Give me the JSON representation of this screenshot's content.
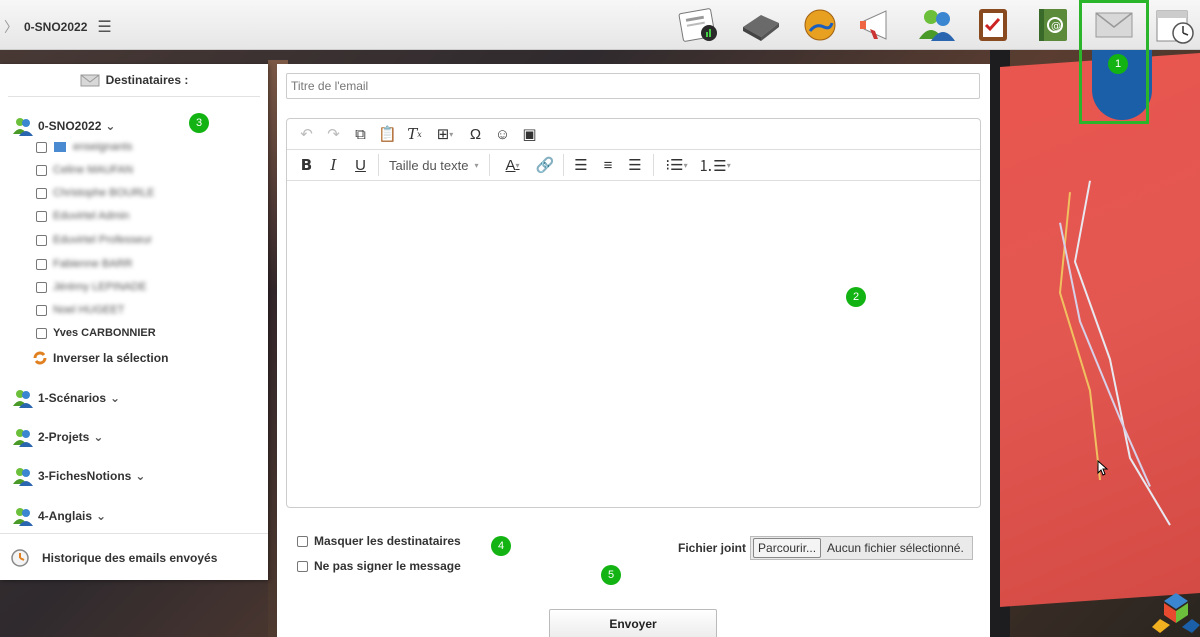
{
  "topbar": {
    "crumb": "0-SNO2022",
    "icons": [
      "newspaper-icon",
      "folder-icon",
      "web-link-icon",
      "megaphone-icon",
      "users-icon",
      "checklist-icon",
      "address-book-icon",
      "mail-icon",
      "calendar-clock-icon"
    ]
  },
  "left": {
    "header": "Destinataires :",
    "groups": [
      {
        "name": "0-SNO2022"
      },
      {
        "name": "1-Scénarios"
      },
      {
        "name": "2-Projets"
      },
      {
        "name": "3-FichesNotions"
      },
      {
        "name": "4-Anglais"
      }
    ],
    "members": [
      "enseignants",
      "Celine MAUFAN",
      "Christophe BOURLE",
      "Eduvirtel Admin",
      "Eduvirtel Professeur",
      "Fabienne BARR",
      "Jérémy LEPINADE",
      "Noel HUGEET",
      "Yves CARBONNIER"
    ],
    "invert": "Inverser la sélection",
    "history": "Historique des emails envoyés"
  },
  "form": {
    "title_placeholder": "Titre de l'email",
    "font_size_label": "Taille du texte",
    "hide_recipients": "Masquer les destinataires",
    "no_sign": "Ne pas signer le message",
    "attachment_label": "Fichier joint",
    "browse": "Parcourir...",
    "no_file": "Aucun fichier sélectionné.",
    "send": "Envoyer"
  },
  "markers": [
    "1",
    "2",
    "3",
    "4",
    "5"
  ],
  "colors": {
    "marker": "#13b313",
    "highlight": "#2bb52b"
  }
}
